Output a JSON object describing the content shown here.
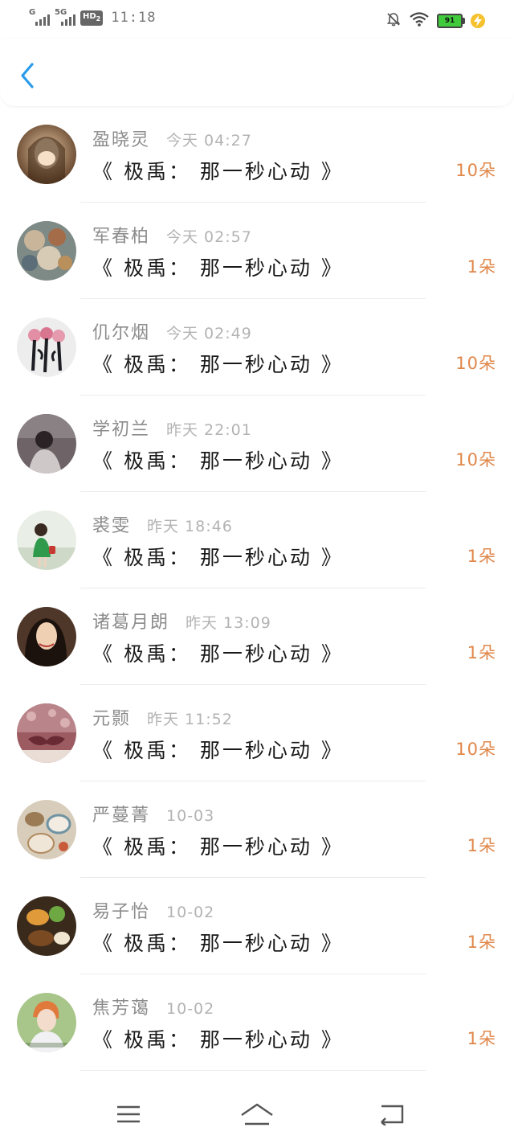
{
  "status_bar": {
    "signal1_label": "G",
    "signal2_label": "5G",
    "hd_label": "HD",
    "hd_sub": "2",
    "time": "11:18",
    "battery_level": "91"
  },
  "colors": {
    "accent_blue": "#2a9bea",
    "count_orange": "#e0874a",
    "name_gray": "#8c8c8c",
    "time_gray": "#b3b3b3",
    "battery_green": "#3fcb3c"
  },
  "icons": {
    "back": "chevron-left-icon",
    "menu": "menu-icon",
    "home": "home-icon",
    "return": "return-icon",
    "mute": "bell-off-icon",
    "wifi": "wifi-icon",
    "battery": "battery-icon",
    "charging": "bolt-icon"
  },
  "list": [
    {
      "name": "盈晓灵",
      "time": "今天 04:27",
      "title": "《 极禹： 那一秒心动 》",
      "count": "10朵"
    },
    {
      "name": "军春柏",
      "time": "今天 02:57",
      "title": "《 极禹： 那一秒心动 》",
      "count": "1朵"
    },
    {
      "name": "仉尔烟",
      "time": "今天 02:49",
      "title": "《 极禹： 那一秒心动 》",
      "count": "10朵"
    },
    {
      "name": "学初兰",
      "time": "昨天 22:01",
      "title": "《 极禹： 那一秒心动 》",
      "count": "10朵"
    },
    {
      "name": "裘雯",
      "time": "昨天 18:46",
      "title": "《 极禹： 那一秒心动 》",
      "count": "1朵"
    },
    {
      "name": "诸葛月朗",
      "time": "昨天 13:09",
      "title": "《 极禹： 那一秒心动 》",
      "count": "1朵"
    },
    {
      "name": "元颢",
      "time": "昨天 11:52",
      "title": "《 极禹： 那一秒心动 》",
      "count": "10朵"
    },
    {
      "name": "严蔓菁",
      "time": "10-03",
      "title": "《 极禹： 那一秒心动 》",
      "count": "1朵"
    },
    {
      "name": "易子怡",
      "time": "10-02",
      "title": "《 极禹： 那一秒心动 》",
      "count": "1朵"
    },
    {
      "name": "焦芳蔼",
      "time": "10-02",
      "title": "《 极禹： 那一秒心动 》",
      "count": "1朵"
    }
  ]
}
